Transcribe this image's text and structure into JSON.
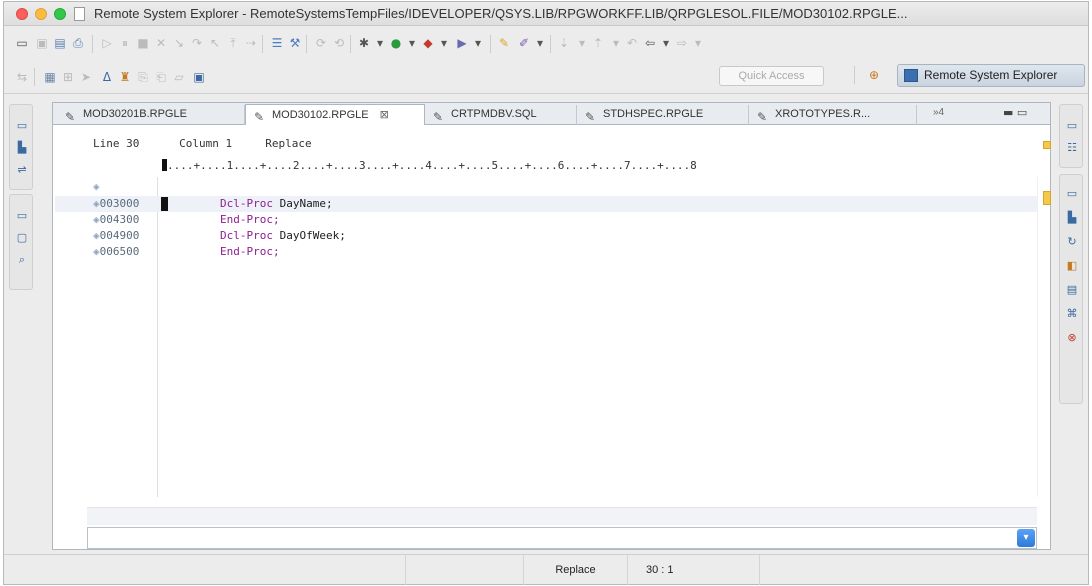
{
  "window": {
    "title": "Remote System Explorer - RemoteSystemsTempFiles/IDEVELOPER/QSYS.LIB/RPGWORKFF.LIB/QRPGLESOL.FILE/MOD30102.RPGLE..."
  },
  "toolbar": {
    "quick_access_placeholder": "Quick Access",
    "perspective_label": "Remote System Explorer"
  },
  "editor": {
    "tabs": [
      {
        "label": "MOD30201B.RPGLE",
        "active": false
      },
      {
        "label": "MOD30102.RPGLE",
        "active": true,
        "close": "⊠"
      },
      {
        "label": "CRTPMDBV.SQL",
        "active": false
      },
      {
        "label": "STDHSPEC.RPGLE",
        "active": false
      },
      {
        "label": "XROTOTYPES.R...",
        "active": false
      }
    ],
    "tab_overflow": "»4",
    "header": {
      "line": "Line 30",
      "column": "Column 1",
      "mode": "Replace"
    },
    "ruler": "....+....1....+....2....+....3....+....4....+....5....+....6....+....7....+....8",
    "rows": [
      {
        "seq": "",
        "kw": "",
        "ident": ""
      },
      {
        "seq": "003000",
        "kw": "Dcl-Proc",
        "ident": " DayName;"
      },
      {
        "seq": "004300",
        "kw": "End-Proc;",
        "ident": ""
      },
      {
        "seq": "004900",
        "kw": "Dcl-Proc",
        "ident": " DayOfWeek;"
      },
      {
        "seq": "006500",
        "kw": "End-Proc;",
        "ident": ""
      }
    ]
  },
  "statusbar": {
    "mode": "Replace",
    "position": "30 : 1"
  }
}
